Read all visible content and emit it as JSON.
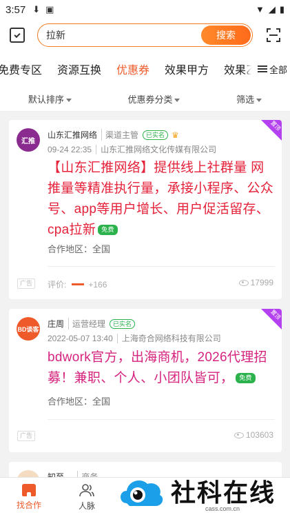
{
  "status": {
    "time": "3:57"
  },
  "search": {
    "value": "拉新",
    "button": "搜索"
  },
  "tabs": [
    "免费专区",
    "资源互换",
    "优惠券",
    "效果甲方",
    "效果乙方"
  ],
  "tabs_more": "全部",
  "filters": [
    "默认排序",
    "优惠券分类",
    "筛选"
  ],
  "cards": [
    {
      "avatar_text": "汇推",
      "name": "山东汇推网络",
      "role": "渠道主管",
      "verified": "已实名",
      "date": "09-24 22:35",
      "company": "山东汇推网络文化传媒有限公司",
      "title": "【山东汇推网络】提供线上社群量 网推量等精准执行量，承接小程序、公众号、app等用户增长、用户促活留存、cpa拉新",
      "free": "免费",
      "region": "合作地区：全国",
      "ad": "广告",
      "rating_label": "评价:",
      "rating_count": "+166",
      "views": "17999",
      "corner": "置顶"
    },
    {
      "avatar_text": "BD谈客",
      "name": "庄周",
      "role": "运营经理",
      "verified": "已实名",
      "date": "2022-05-07 13:40",
      "company": "上海奇合网络科技有限公司",
      "title": "bdwork官方，出海商机，2026代理招募！兼职、个人、小团队皆可，",
      "free": "免费",
      "region": "合作地区：全国",
      "ad": "广告",
      "views": "103603",
      "corner": "置顶"
    },
    {
      "name": "知至 ...",
      "role": "商务"
    }
  ],
  "nav": {
    "home": "找合作",
    "contacts": "人脉"
  },
  "watermark": {
    "text": "社科在线",
    "url": "cass.com.cn"
  }
}
